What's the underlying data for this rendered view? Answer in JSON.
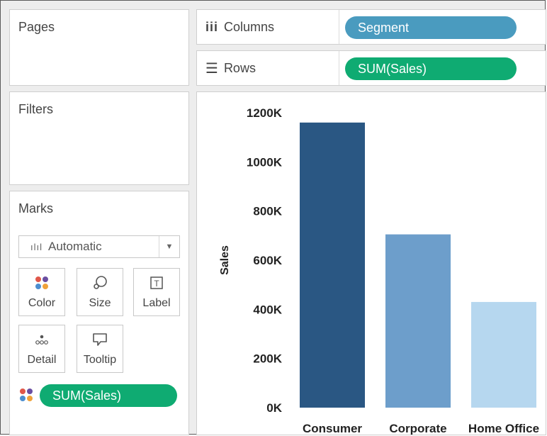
{
  "pages": {
    "title": "Pages"
  },
  "columns_shelf": {
    "label": "Columns",
    "pill": "Segment"
  },
  "rows_shelf": {
    "label": "Rows",
    "pill": "SUM(Sales)"
  },
  "filters": {
    "title": "Filters"
  },
  "marks": {
    "title": "Marks",
    "mark_type": "Automatic",
    "buttons": [
      {
        "label": "Color",
        "icon": "color-dots-icon"
      },
      {
        "label": "Size",
        "icon": "size-icon"
      },
      {
        "label": "Label",
        "icon": "label-icon"
      },
      {
        "label": "Detail",
        "icon": "detail-icon"
      },
      {
        "label": "Tooltip",
        "icon": "tooltip-icon"
      }
    ],
    "color_pill": "SUM(Sales)"
  },
  "colors": {
    "columns_pill": "#4a9bbf",
    "rows_pill": "#0fab72",
    "bar_consumer": "#2a5783",
    "bar_corporate": "#6d9ecb",
    "bar_home_office": "#b6d7ef"
  },
  "chart_data": {
    "type": "bar",
    "categories": [
      "Consumer",
      "Corporate",
      "Home Office"
    ],
    "values": [
      1160000,
      705000,
      430000
    ],
    "colors": [
      "#2a5783",
      "#6d9ecb",
      "#b6d7ef"
    ],
    "ylabel": "Sales",
    "yticks": [
      "0K",
      "200K",
      "400K",
      "600K",
      "800K",
      "1000K",
      "1200K"
    ],
    "ytick_values": [
      0,
      200000,
      400000,
      600000,
      800000,
      1000000,
      1200000
    ],
    "ylim": [
      0,
      1200000
    ],
    "grid": false
  }
}
